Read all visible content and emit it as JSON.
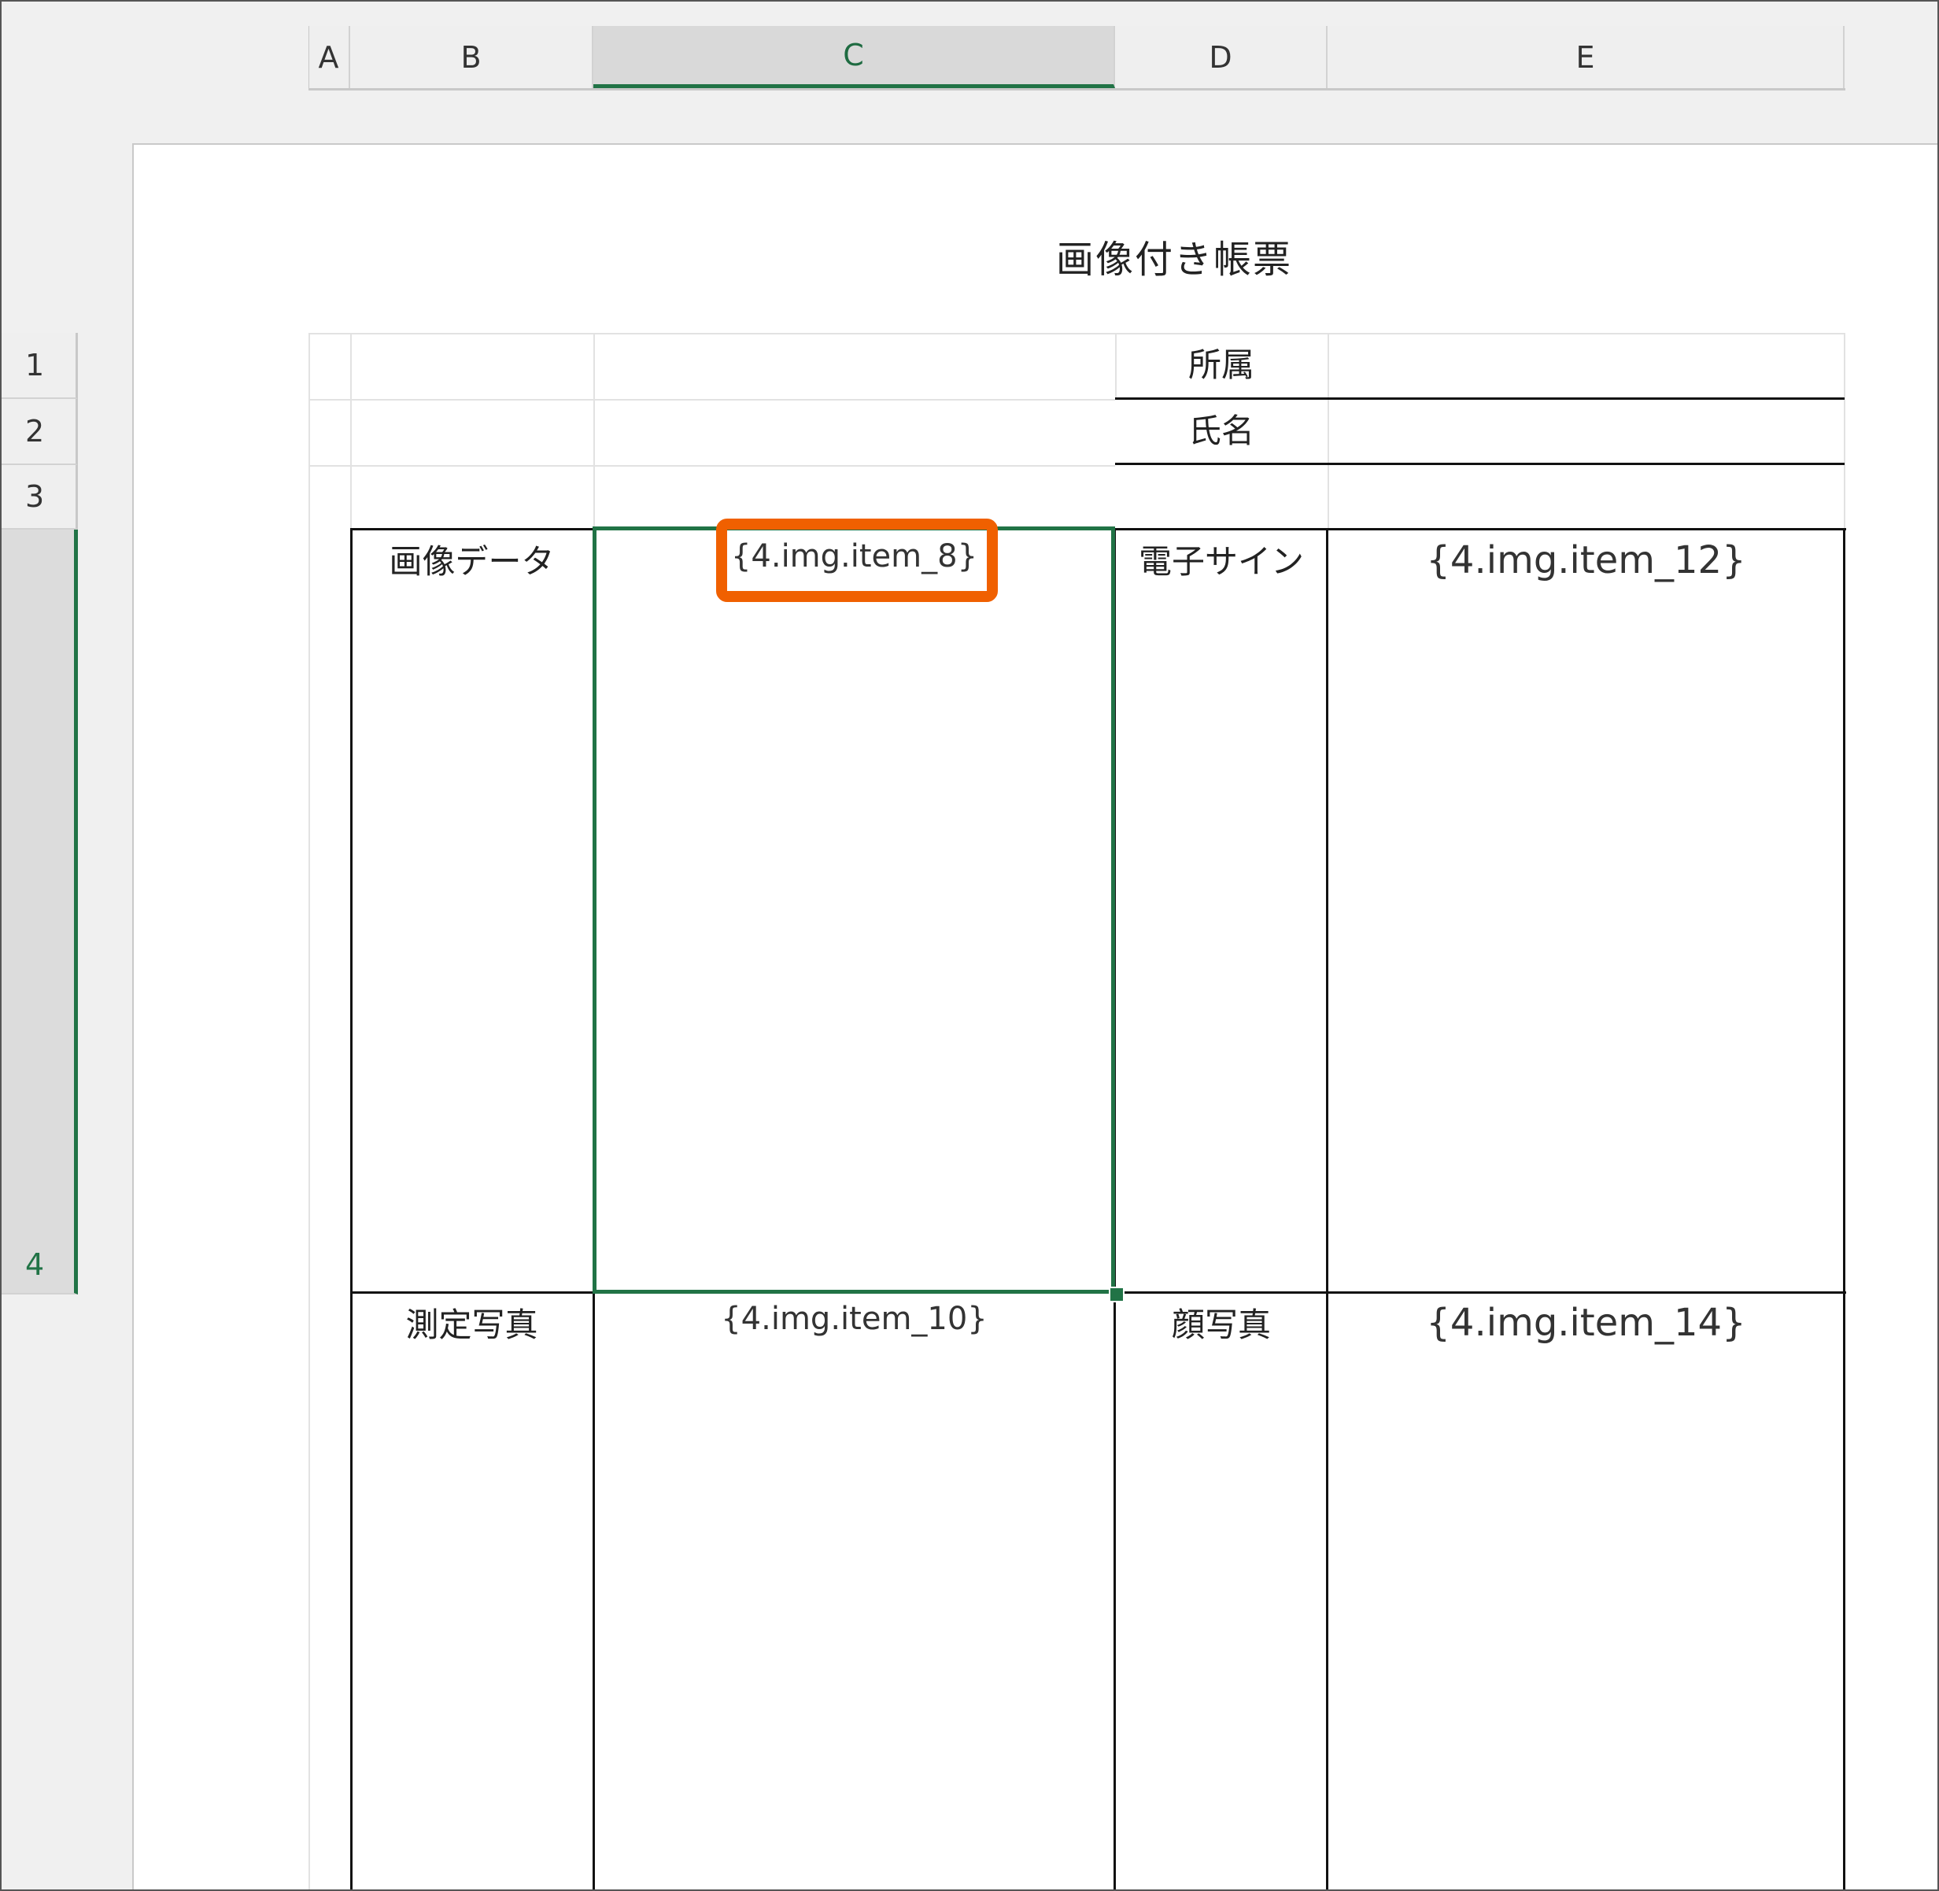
{
  "columns": [
    {
      "label": "A"
    },
    {
      "label": "B"
    },
    {
      "label": "C",
      "selected": true
    },
    {
      "label": "D"
    },
    {
      "label": "E"
    }
  ],
  "rows": [
    {
      "label": "1"
    },
    {
      "label": "2"
    },
    {
      "label": "3"
    },
    {
      "label": "4",
      "selected": true
    }
  ],
  "sheet": {
    "title": "画像付き帳票",
    "fields": {
      "affiliation": "所属",
      "name": "氏名"
    },
    "labels": {
      "image_data": "画像データ",
      "e_sign": "電子サイン",
      "measure_photo": "測定写真",
      "face_photo": "顔写真"
    },
    "placeholders": {
      "item_8": "{4.img.item_8}",
      "item_10": "{4.img.item_10}",
      "item_12": "{4.img.item_12}",
      "item_14": "{4.img.item_14}"
    }
  },
  "colors": {
    "selection": "#217346",
    "highlight": "#f06000",
    "border": "#111111",
    "gridline": "#e2e2e2"
  }
}
